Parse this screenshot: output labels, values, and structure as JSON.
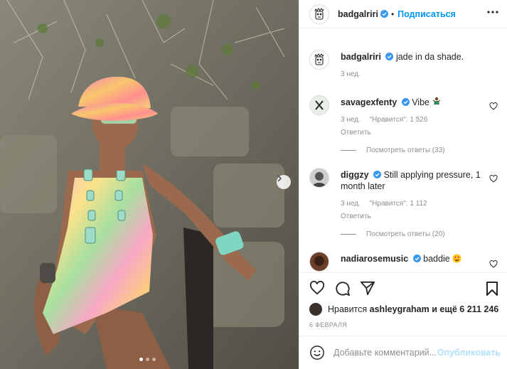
{
  "post": {
    "username": "badgalriri",
    "follow_label": "Подписаться",
    "caption": "jade in da shade.",
    "caption_age": "3 нед.",
    "carousel": {
      "slides": 3,
      "active": 1
    }
  },
  "comments": [
    {
      "username": "savagexfenty",
      "text": "Vibe",
      "emoji": "dancer",
      "age": "3 нед.",
      "likes": "\"Нравится\": 1 526",
      "reply": "Ответить",
      "view_replies": "Посмотреть ответы (33)"
    },
    {
      "username": "diggzy",
      "text": "Still applying pressure, 1 month later",
      "age": "3 нед.",
      "likes": "\"Нравится\": 1 112",
      "reply": "Ответить",
      "view_replies": "Посмотреть ответы (20)"
    },
    {
      "username": "nadiarosemusic",
      "text": "baddie",
      "emoji": "heart-eyes"
    }
  ],
  "likes": {
    "prefix": "Нравится",
    "user": "ashleygraham",
    "suffix": "и ещё 6 211 246"
  },
  "date": "6 ФЕВРАЛЯ",
  "add_comment": {
    "placeholder": "Добавьте комментарий...",
    "publish": "Опубликовать"
  },
  "colors": {
    "accent": "#0095f6",
    "verified": "#3897f0",
    "publish_disabled": "#b2dffc"
  }
}
